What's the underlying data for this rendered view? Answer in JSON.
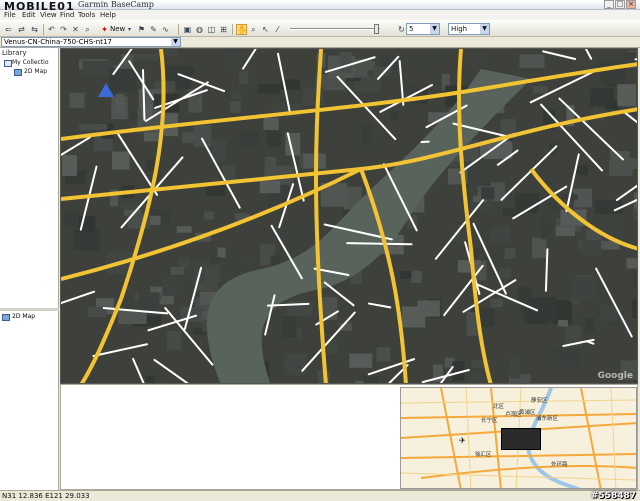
{
  "window": {
    "logo_text": "MOBILE01",
    "title": "Garmin BaseCamp",
    "minimize": "_",
    "maximize": "□",
    "close": "×"
  },
  "menu": {
    "items": [
      "File",
      "Edit",
      "View",
      "Find",
      "Tools",
      "Help"
    ]
  },
  "toolbar": {
    "new_label": "New",
    "zoom_value": "5",
    "detail_value": "High"
  },
  "dataset": {
    "selected": "Venus-CN-China-750-CHS-nt17"
  },
  "library": {
    "header": "Library",
    "items": [
      "My Collectio",
      "2D Map"
    ]
  },
  "list": {
    "items": [
      "2D Map"
    ]
  },
  "map": {
    "labels": [
      "Google"
    ]
  },
  "overview": {
    "labels": [
      "静安区",
      "北区",
      "浦东新区",
      "长宁区",
      "徐汇区",
      "外环路",
      "黄浦区",
      "卢湾区"
    ]
  },
  "status": {
    "coords": "N31 12.836 E121 29.033",
    "watermark": "#558487"
  },
  "colors": {
    "road_major": "#f2c433",
    "road_minor": "#ffffff",
    "river": "#58635c",
    "toolbar_active": "#ffd98a"
  }
}
